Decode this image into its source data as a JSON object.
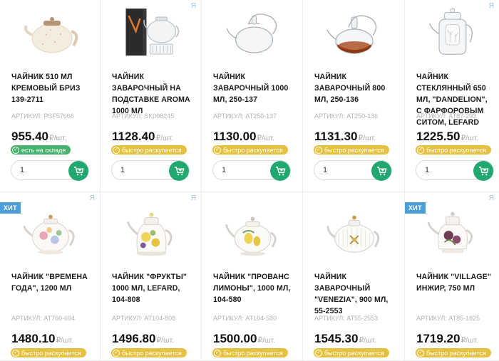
{
  "colors": {
    "accent": "#20a870",
    "in_stock": "#45b36b",
    "selling_fast": "#e6c13f",
    "hit": "#4a9fd8"
  },
  "products": [
    {
      "title": "ЧАЙНИК 510 МЛ КРЕМОВЫЙ БРИЗ 139-2711",
      "sku": "АРТИКУЛ: PSF57666",
      "price": "955.40",
      "unit": "₽/шт.",
      "status": "есть на складе",
      "status_type": "green",
      "qty": "1",
      "hit": "",
      "ya": ""
    },
    {
      "title": "ЧАЙНИК ЗАВАРОЧНЫЙ НА ПОДСТАВКЕ AROMA 1000 МЛ",
      "sku": "АРТИКУЛ: SK008245",
      "price": "1128.40",
      "unit": "₽/шт.",
      "status": "быстро раскупается",
      "status_type": "yellow",
      "qty": "1",
      "hit": "",
      "ya": "Я"
    },
    {
      "title": "ЧАЙНИК ЗАВАРОЧНЫЙ 1000 МЛ, 250-137",
      "sku": "АРТИКУЛ: AT250-137",
      "price": "1130.00",
      "unit": "₽/шт.",
      "status": "быстро раскупается",
      "status_type": "yellow",
      "qty": "1",
      "hit": "",
      "ya": ""
    },
    {
      "title": "ЧАЙНИК ЗАВАРОЧНЫЙ 800 МЛ, 250-136",
      "sku": "АРТИКУЛ: AT250-136",
      "price": "1131.30",
      "unit": "₽/шт.",
      "status": "быстро раскупается",
      "status_type": "yellow",
      "qty": "1",
      "hit": "",
      "ya": ""
    },
    {
      "title": "ЧАЙНИК СТЕКЛЯННЫЙ 650 МЛ, \"DANDELION\", С ФАРФОРОВЫМ СИТОМ, LEFARD",
      "sku": "АРТИКУЛ: AT87-293",
      "price": "1225.50",
      "unit": "₽/шт.",
      "status": "быстро раскупается",
      "status_type": "yellow",
      "qty": "1",
      "hit": "",
      "ya": "Я"
    },
    {
      "title": "ЧАЙНИК \"ВРЕМЕНА ГОДА\", 1200 МЛ",
      "sku": "АРТИКУЛ: AT760-694",
      "price": "1480.10",
      "unit": "₽/шт.",
      "status": "быстро раскупается",
      "status_type": "yellow",
      "qty": "",
      "hit": "ХИТ",
      "ya": "Я"
    },
    {
      "title": "ЧАЙНИК \"ФРУКТЫ\" 1000 МЛ, LEFARD, 104-808",
      "sku": "АРТИКУЛ: AT104-808",
      "price": "1496.80",
      "unit": "₽/шт.",
      "status": "быстро раскупается",
      "status_type": "yellow",
      "qty": "",
      "hit": "",
      "ya": "Я"
    },
    {
      "title": "ЧАЙНИК \"ПРОВАНС ЛИМОНЫ\", 1000 МЛ, 104-580",
      "sku": "АРТИКУЛ: AT104-580",
      "price": "1500.00",
      "unit": "₽/шт.",
      "status": "быстро раскупается",
      "status_type": "yellow",
      "qty": "",
      "hit": "",
      "ya": ""
    },
    {
      "title": "ЧАЙНИК ЗАВАРОЧНЫЙ \"VENEZIA\", 900 МЛ, 55-2553",
      "sku": "АРТИКУЛ: AT55-2553",
      "price": "1545.30",
      "unit": "₽/шт.",
      "status": "быстро раскупается",
      "status_type": "yellow",
      "qty": "",
      "hit": "",
      "ya": ""
    },
    {
      "title": "ЧАЙНИК \"VILLAGE\" ИНЖИР, 750 МЛ",
      "sku": "АРТИКУЛ: AT85-1825",
      "price": "1719.20",
      "unit": "₽/шт.",
      "status": "быстро раскупается",
      "status_type": "yellow",
      "qty": "",
      "hit": "ХИТ",
      "ya": "Я"
    }
  ]
}
